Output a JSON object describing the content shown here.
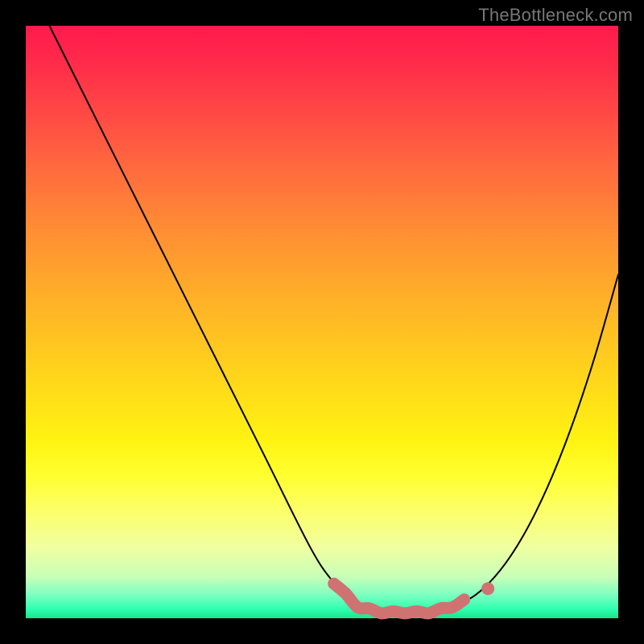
{
  "watermark": "TheBottleneck.com",
  "colors": {
    "frame_bg": "#000000",
    "curve_stroke": "#000000",
    "highlight_stroke": "#d17272",
    "watermark_text": "#777777"
  },
  "chart_data": {
    "type": "line",
    "title": "",
    "xlabel": "",
    "ylabel": "",
    "xlim": [
      0,
      100
    ],
    "ylim": [
      0,
      100
    ],
    "grid": false,
    "legend_position": "none",
    "series": [
      {
        "name": "bottleneck-curve",
        "x": [
          4,
          10,
          20,
          30,
          40,
          48,
          52,
          56,
          60,
          64,
          68,
          72,
          76,
          80,
          84,
          88,
          92,
          96,
          100
        ],
        "y": [
          100,
          88,
          68,
          48,
          28,
          12,
          6,
          2,
          1,
          1,
          1,
          2,
          4,
          8,
          14,
          22,
          32,
          44,
          58
        ]
      }
    ],
    "annotations": [
      {
        "name": "optimal-range-segment",
        "x_start": 52,
        "x_end": 75,
        "style": "thick-rounded",
        "color": "#d17272"
      },
      {
        "name": "optimal-point-dot",
        "x": 78,
        "y": 5,
        "style": "dot",
        "color": "#d17272"
      }
    ],
    "background_gradient": {
      "top": "#ff1a4d",
      "mid_upper": "#ff8c34",
      "mid": "#fff312",
      "mid_lower": "#f0ffa0",
      "bottom": "#17e58a"
    }
  }
}
